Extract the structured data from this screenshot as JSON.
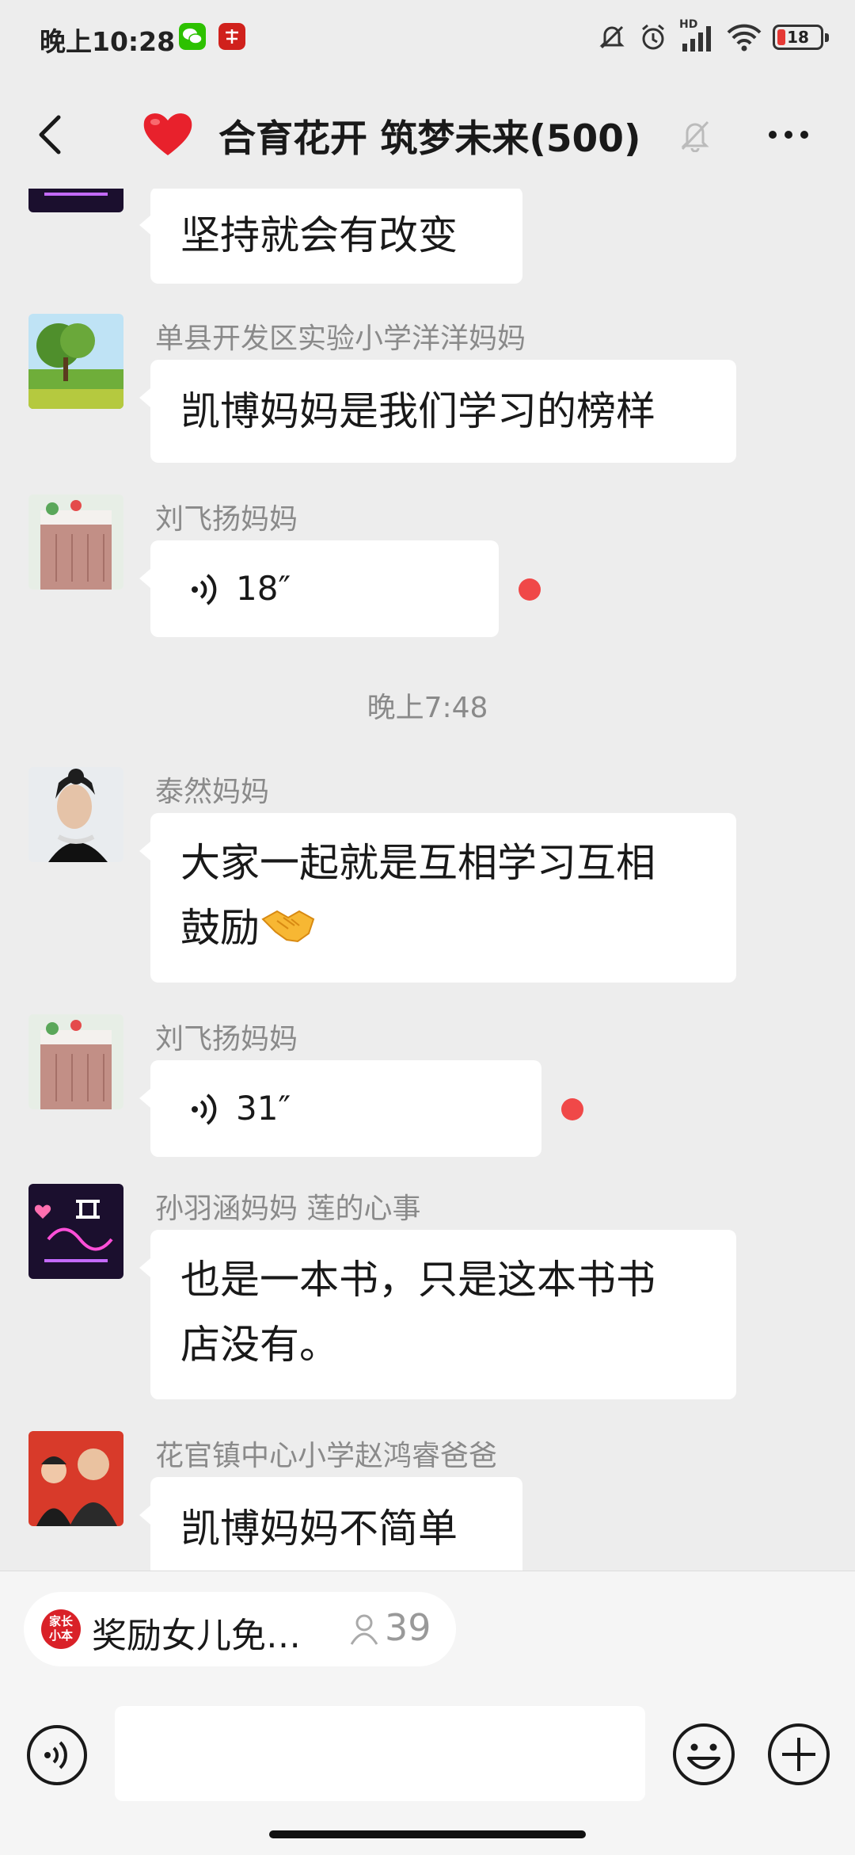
{
  "status_bar": {
    "time": "晚上10:28",
    "battery": "18",
    "network_badge": "HD",
    "icons": [
      "wechat-icon",
      "xuexi-app-icon",
      "mute-vibrate-icon",
      "alarm-icon",
      "signal-icon",
      "wifi-icon",
      "battery-icon"
    ]
  },
  "header": {
    "title": "合育花开 筑梦未来(500)",
    "icons": [
      "back-icon",
      "heart-icon",
      "mute-bell-icon",
      "more-icon"
    ]
  },
  "messages": [
    {
      "sender": "",
      "text": "坚持就会有改变",
      "avatar": "neon-sign-avatar"
    },
    {
      "sender": "单县开发区实验小学洋洋妈妈",
      "text": "凯博妈妈是我们学习的榜样",
      "avatar": "tree-landscape-avatar"
    },
    {
      "sender": "刘飞扬妈妈",
      "voice_duration": "18″",
      "unread": true,
      "avatar": "cake-avatar"
    },
    {
      "timestamp": "晚上7:48"
    },
    {
      "sender": "泰然妈妈",
      "text_lines": [
        "大家一起就是互相学习互相",
        "鼓励"
      ],
      "emoji": "handshake",
      "avatar": "woman-portrait-avatar"
    },
    {
      "sender": "刘飞扬妈妈",
      "voice_duration": "31″",
      "unread": true,
      "avatar": "cake-avatar"
    },
    {
      "sender": "孙羽涵妈妈  莲的心事",
      "text_lines": [
        "也是一本书，只是这本书书",
        "店没有。"
      ],
      "avatar": "neon-sign-avatar"
    },
    {
      "sender": "花官镇中心小学赵鸿睿爸爸",
      "text": "凯博妈妈不简单",
      "avatar": "father-son-avatar"
    }
  ],
  "notice": {
    "logo_line1": "家长",
    "logo_line2": "小本",
    "text": "奖励女儿免…",
    "count": "39"
  },
  "colors": {
    "background": "#ededed",
    "bubble": "#ffffff",
    "unread_dot": "#f04848",
    "sender_text": "#8a8a8a"
  }
}
